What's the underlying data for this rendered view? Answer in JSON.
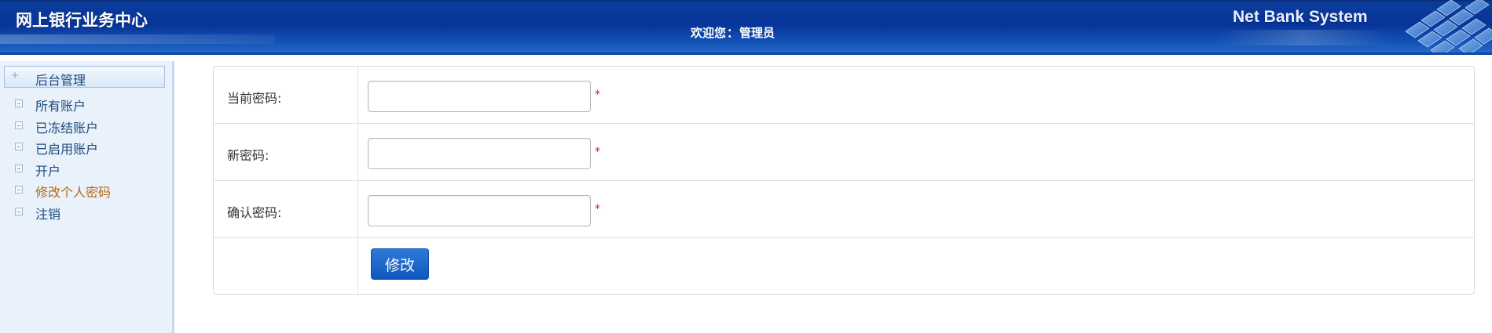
{
  "header": {
    "brand": "网上银行业务中心",
    "welcome_prefix": "欢迎您",
    "welcome_sep": "：",
    "username": "管理员",
    "system_name": "Net Bank System"
  },
  "sidebar": {
    "section_title": "后台管理",
    "items": [
      {
        "label": "所有账户",
        "active": false
      },
      {
        "label": "已冻结账户",
        "active": false
      },
      {
        "label": "已启用账户",
        "active": false
      },
      {
        "label": "开户",
        "active": false
      },
      {
        "label": "修改个人密码",
        "active": true
      },
      {
        "label": "注销",
        "active": false
      }
    ]
  },
  "form": {
    "fields": [
      {
        "label": "当前密码:",
        "value": "",
        "required_mark": "*"
      },
      {
        "label": "新密码:",
        "value": "",
        "required_mark": "*"
      },
      {
        "label": "确认密码:",
        "value": "",
        "required_mark": "*"
      }
    ],
    "submit_label": "修改"
  },
  "colors": {
    "header_blue": "#07349a",
    "sidebar_bg": "#e9f1fa",
    "active_menu": "#b66a10",
    "required": "#e02020",
    "button": "#1565c8"
  }
}
